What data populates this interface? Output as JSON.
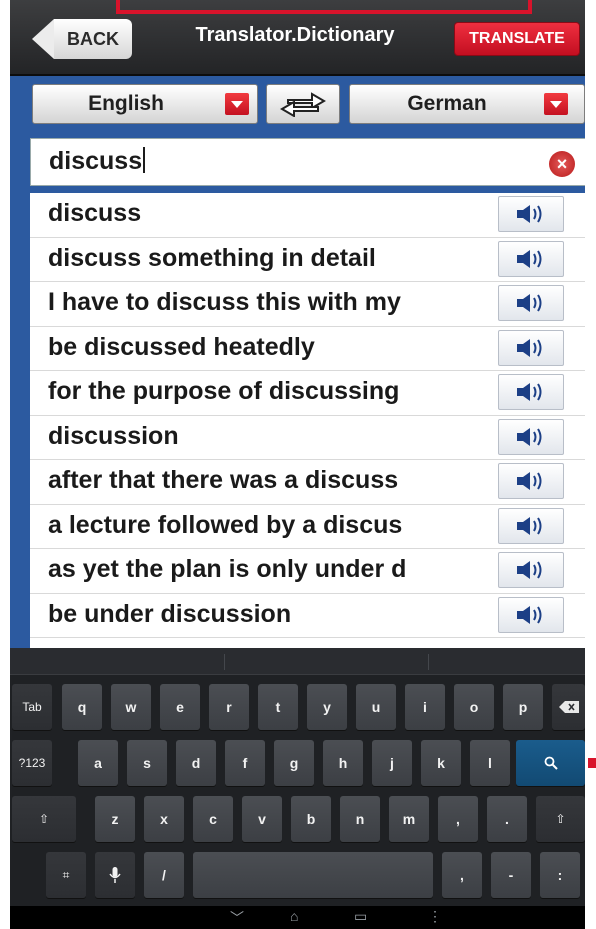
{
  "header": {
    "back_label": "BACK",
    "title": "Translator.Dictionary",
    "translate_label": "TRANSLATE"
  },
  "languages": {
    "source": "English",
    "target": "German"
  },
  "search": {
    "value": "discuss"
  },
  "results": [
    "discuss",
    "discuss something in detail",
    "I have to discuss this with my",
    "be discussed heatedly",
    "for the purpose of discussing",
    "discussion",
    "after that there was a discuss",
    "a lecture followed by a discus",
    "as yet the plan is only under d",
    "be under discussion"
  ],
  "keyboard": {
    "row1": [
      "Tab",
      "q",
      "w",
      "e",
      "r",
      "t",
      "y",
      "u",
      "i",
      "o",
      "p"
    ],
    "row2": [
      "?123",
      "a",
      "s",
      "d",
      "f",
      "g",
      "h",
      "j",
      "k",
      "l"
    ],
    "row3": [
      "⇧",
      "z",
      "x",
      "c",
      "v",
      "b",
      "n",
      "m",
      ",",
      ".",
      "⇧"
    ],
    "row4": [
      "⌗",
      "🎤",
      "/",
      "",
      ",",
      "-",
      ":"
    ],
    "hints": {
      "comma": "!",
      "period": "?",
      "slash": "@",
      "dash": "_",
      "colon": "+",
      "apos": "\""
    }
  },
  "colors": {
    "accent_blue": "#2c5aa0",
    "accent_red": "#d8132b",
    "key": "#3c3f44"
  },
  "icons": [
    "back-arrow-icon",
    "dropdown-icon",
    "swap-icon",
    "clear-icon",
    "speaker-icon",
    "backspace-icon",
    "search-icon",
    "shift-icon",
    "mic-icon",
    "home-icon",
    "recents-icon"
  ]
}
